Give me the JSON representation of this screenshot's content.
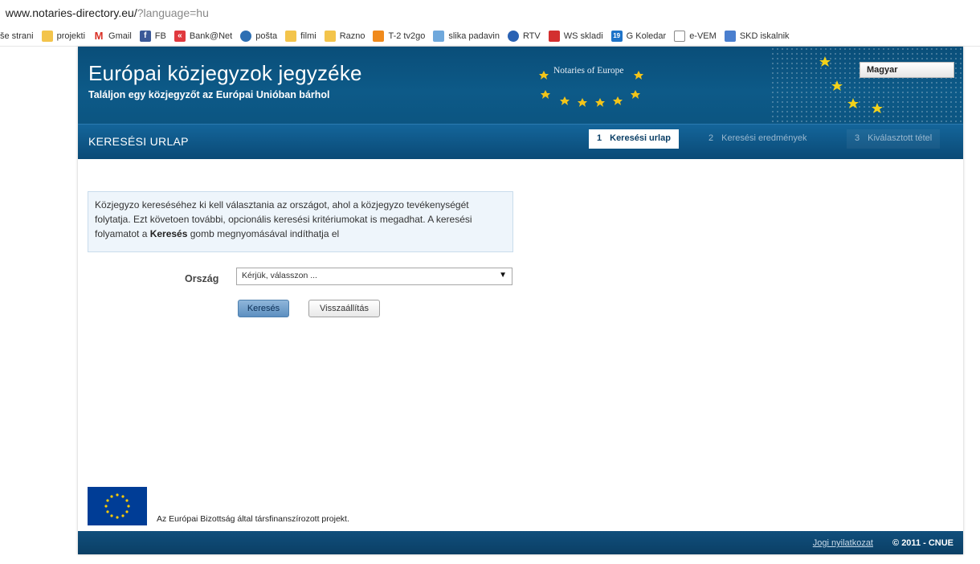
{
  "browser": {
    "url_prefix": " www.notaries-directory.eu/",
    "url_query": "?language=hu",
    "bookmarks": [
      {
        "label": "še strani",
        "icon": "none"
      },
      {
        "label": "projekti",
        "icon": "folder-icon"
      },
      {
        "label": "Gmail",
        "icon": "gmail-icon"
      },
      {
        "label": "FB",
        "icon": "facebook-icon"
      },
      {
        "label": "Bank@Net",
        "icon": "bank-icon"
      },
      {
        "label": "pošta",
        "icon": "mail-icon"
      },
      {
        "label": "filmi",
        "icon": "folder-icon"
      },
      {
        "label": "Razno",
        "icon": "folder-icon"
      },
      {
        "label": "T-2 tv2go",
        "icon": "tv-icon"
      },
      {
        "label": "slika padavin",
        "icon": "weather-icon"
      },
      {
        "label": "RTV",
        "icon": "rtv-icon"
      },
      {
        "label": "WS skladi",
        "icon": "ws-icon"
      },
      {
        "label": "G Koledar",
        "icon": "calendar-icon"
      },
      {
        "label": "e-VEM",
        "icon": "page-icon"
      },
      {
        "label": "SKD iskalnik",
        "icon": "search-page-icon"
      }
    ]
  },
  "header": {
    "title": "Európai közjegyzok jegyzéke",
    "subtitle": "Találjon egy közjegyzőt az Európai Unióban bárhol",
    "logo_text": "Notaries of Europe",
    "language": "Magyar"
  },
  "nav": {
    "page_title": "KERESÉSI URLAP",
    "steps": [
      {
        "num": "1",
        "label": "Keresési urlap"
      },
      {
        "num": "2",
        "label": "Keresési eredmények"
      },
      {
        "num": "3",
        "label": "Kiválasztott tétel"
      }
    ]
  },
  "main": {
    "info_text_1": "Közjegyzo kereséséhez ki kell választania az országot, ahol a közjegyzo tevékenységét folytatja. Ezt követoen további, opcionális keresési kritériumokat is megadhat. A keresési folyamatot a ",
    "info_text_bold": "Keresés",
    "info_text_2": " gomb megnyomásával indíthatja el",
    "country_label": "Ország",
    "country_select_value": "Kérjük, válasszon ...",
    "search_button": "Keresés",
    "reset_button": "Visszaállítás"
  },
  "footer": {
    "funded_text": "Az Európai Bizottság által társfinanszírozott projekt.",
    "legal_link": "Jogi nyilatkozat",
    "copyright": "© 2011 - CNUE"
  },
  "colors": {
    "header_blue": "#0d5a88",
    "nav_blue": "#0a4a76",
    "info_bg": "#eef5fb",
    "eu_blue": "#003d96",
    "eu_gold": "#ffcc00"
  }
}
